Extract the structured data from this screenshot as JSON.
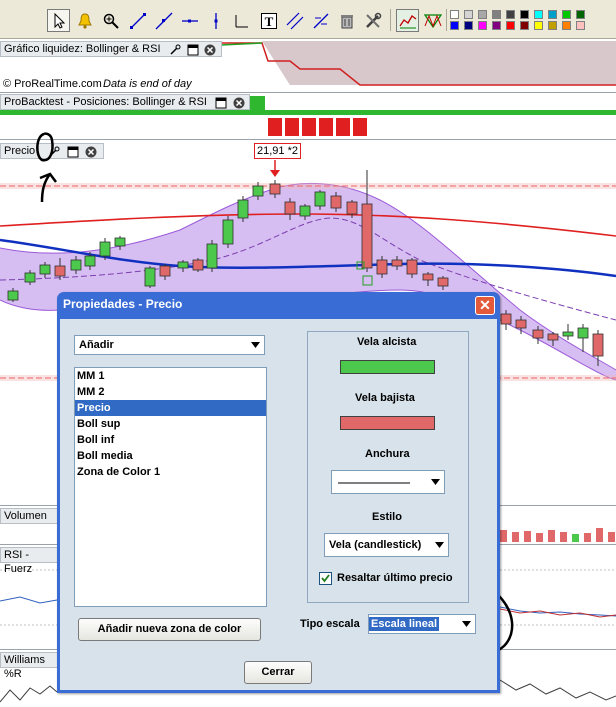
{
  "toolbar": {
    "tools": [
      "cursor-icon",
      "alarm-bell-icon",
      "zoom-icon",
      "line-icon",
      "line-icon",
      "horizontal-line-icon",
      "vertical-line-icon",
      "text-icon",
      "channel-icon",
      "fibonacci-icon",
      "trash-icon",
      "tools-icon",
      "indicator-icon",
      "pattern-icon"
    ],
    "colors": [
      "#ffffff",
      "#d4d4d4",
      "#a8a8a8",
      "#808080",
      "#404040",
      "#000000",
      "#00ffff",
      "#00a0c8",
      "#00c800",
      "#006400",
      "#0000ff",
      "#000080",
      "#ff00ff",
      "#800080",
      "#ff0000",
      "#800000",
      "#ffff00",
      "#c0a000",
      "#ff8000",
      "#ffc0c0"
    ]
  },
  "panels": {
    "liquidity_title": "Gráfico liquidez: Bollinger & RSI",
    "copyright": "© ProRealTime.com",
    "eod_note": "Data is end of day",
    "backtest_title": "ProBacktest - Posiciones: Bollinger & RSI",
    "price_title": "Precio",
    "price_label": "21,91 *2",
    "volume_title": "Volumen",
    "rsi_title": "RSI - Fuerz",
    "williams_title": "Williams %R"
  },
  "dialog": {
    "title": "Propiedades - Precio",
    "add_combo": "Añadir",
    "list_items": [
      "MM 1",
      "MM 2",
      "Precio",
      "Boll sup",
      "Boll inf",
      "Boll media",
      "Zona de Color 1"
    ],
    "selected_item": "Precio",
    "add_zone_button": "Añadir nueva zona de color",
    "bullish_label": "Vela alcista",
    "bullish_color": "#4cc94c",
    "bearish_label": "Vela bajista",
    "bearish_color": "#e06868",
    "width_label": "Anchura",
    "style_label": "Estilo",
    "style_value": "Vela (candlestick)",
    "highlight_label": "Resaltar último precio",
    "highlight_checked": true,
    "scale_label": "Tipo escala",
    "scale_value": "Escala lineal",
    "close_button": "Cerrar"
  }
}
